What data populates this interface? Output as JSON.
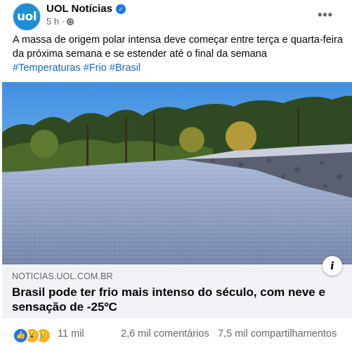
{
  "page": {
    "name": "UOL Notícias",
    "avatar_text": "uol",
    "time": "5 h",
    "more_label": "•••"
  },
  "post": {
    "text": "A massa de origem polar intensa deve começar entre terça e quarta-feira da próxima semana e se estender até o final da semana",
    "hashtags": [
      "#Temperaturas",
      "#Frio",
      "#Brasil"
    ]
  },
  "link": {
    "domain": "NOTICIAS.UOL.COM.BR",
    "headline": "Brasil pode ter frio mais intenso do século, com neve e sensação de -25ºC",
    "info_label": "i"
  },
  "stats": {
    "reactions_count": "11 mil",
    "comments": "2,6 mil comentários",
    "shares": "7,5 mil compartilhamentos",
    "reaction_icons": [
      "like-icon",
      "wow-icon",
      "sad-icon"
    ]
  },
  "colors": {
    "link_blue": "#1467d4",
    "secondary_text": "#65676b",
    "link_box_bg": "#f0f2f5",
    "brand": "#1a8fd6"
  }
}
